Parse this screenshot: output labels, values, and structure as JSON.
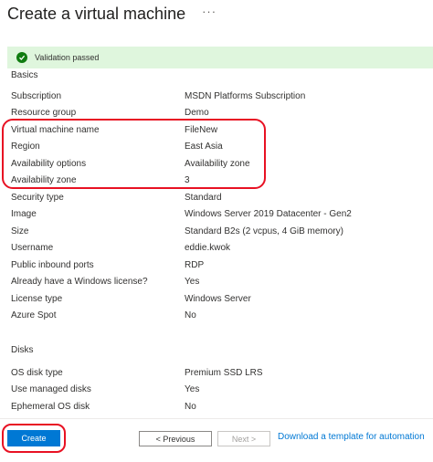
{
  "header": {
    "title": "Create a virtual machine",
    "more": "···"
  },
  "banner": {
    "text": "Validation passed"
  },
  "basics": {
    "heading": "Basics",
    "rows": [
      {
        "key": "Subscription",
        "value": "MSDN Platforms Subscription"
      },
      {
        "key": "Resource group",
        "value": "Demo"
      },
      {
        "key": "Virtual machine name",
        "value": "FileNew"
      },
      {
        "key": "Region",
        "value": "East Asia"
      },
      {
        "key": "Availability options",
        "value": "Availability zone"
      },
      {
        "key": "Availability zone",
        "value": "3"
      },
      {
        "key": "Security type",
        "value": "Standard"
      },
      {
        "key": "Image",
        "value": "Windows Server 2019 Datacenter - Gen2"
      },
      {
        "key": "Size",
        "value": "Standard B2s (2 vcpus, 4 GiB memory)"
      },
      {
        "key": "Username",
        "value": "eddie.kwok"
      },
      {
        "key": "Public inbound ports",
        "value": "RDP"
      },
      {
        "key": "Already have a Windows license?",
        "value": "Yes"
      },
      {
        "key": "License type",
        "value": "Windows Server"
      },
      {
        "key": "Azure Spot",
        "value": "No"
      }
    ]
  },
  "disks": {
    "heading": "Disks",
    "rows": [
      {
        "key": "OS disk type",
        "value": "Premium SSD LRS"
      },
      {
        "key": "Use managed disks",
        "value": "Yes"
      },
      {
        "key": "Ephemeral OS disk",
        "value": "No"
      }
    ]
  },
  "footer": {
    "create_label": "Create",
    "previous_label": "< Previous",
    "next_label": "Next >",
    "download_link": "Download a template for automation"
  },
  "colors": {
    "primary": "#0078d4",
    "success_bg": "#dff6dd",
    "success_icon": "#107c10",
    "annotation": "#e81123"
  }
}
